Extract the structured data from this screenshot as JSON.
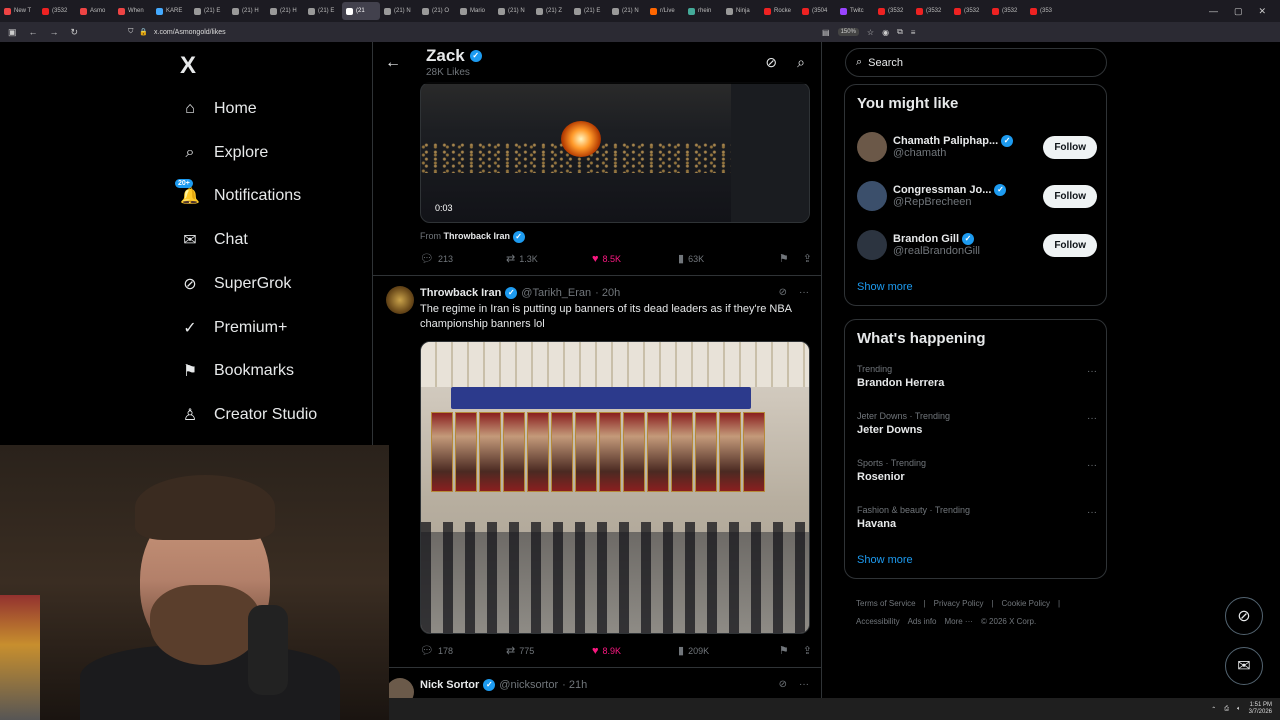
{
  "browser": {
    "tabs": [
      {
        "label": "New T",
        "color": "#e44"
      },
      {
        "label": "(3532",
        "color": "#e22"
      },
      {
        "label": "Asmo",
        "color": "#e44"
      },
      {
        "label": "When",
        "color": "#e44"
      },
      {
        "label": "KARE",
        "color": "#4af"
      },
      {
        "label": "(21) E",
        "color": "#999"
      },
      {
        "label": "(21) H",
        "color": "#999"
      },
      {
        "label": "(21) H",
        "color": "#999"
      },
      {
        "label": "(21) E",
        "color": "#999"
      },
      {
        "label": "(21",
        "color": "#fff",
        "active": true
      },
      {
        "label": "(21) N",
        "color": "#999"
      },
      {
        "label": "(21) O",
        "color": "#999"
      },
      {
        "label": "Mario",
        "color": "#999"
      },
      {
        "label": "(21) N",
        "color": "#999"
      },
      {
        "label": "(21) Z",
        "color": "#999"
      },
      {
        "label": "(21) E",
        "color": "#999"
      },
      {
        "label": "(21) N",
        "color": "#999"
      },
      {
        "label": "r/Live",
        "color": "#f60"
      },
      {
        "label": "rhein",
        "color": "#4a9"
      },
      {
        "label": "Ninja",
        "color": "#999"
      },
      {
        "label": "Rocke",
        "color": "#e22"
      },
      {
        "label": "(3504",
        "color": "#e22"
      },
      {
        "label": "Twitc",
        "color": "#94f"
      },
      {
        "label": "(3532",
        "color": "#e22"
      },
      {
        "label": "(3532",
        "color": "#e22"
      },
      {
        "label": "(3532",
        "color": "#e22"
      },
      {
        "label": "(3532",
        "color": "#e22"
      },
      {
        "label": "(353",
        "color": "#e22"
      }
    ],
    "url": "x.com/Asmongold/likes",
    "zoom": "150%"
  },
  "nav": {
    "logo": "X",
    "items": [
      {
        "label": "Home",
        "icon": "home-icon",
        "glyph": "⌂"
      },
      {
        "label": "Explore",
        "icon": "search-icon",
        "glyph": "⌕"
      },
      {
        "label": "Notifications",
        "icon": "bell-icon",
        "glyph": "🔔"
      },
      {
        "label": "Chat",
        "icon": "mail-icon",
        "glyph": "✉"
      },
      {
        "label": "SuperGrok",
        "icon": "grok-icon",
        "glyph": "⊘"
      },
      {
        "label": "Premium+",
        "icon": "premium-icon",
        "glyph": "✓"
      },
      {
        "label": "Bookmarks",
        "icon": "bookmark-icon",
        "glyph": "⚑"
      },
      {
        "label": "Creator Studio",
        "icon": "creator-icon",
        "glyph": "♙"
      }
    ],
    "notifications_badge": "20+"
  },
  "header": {
    "name": "Zack",
    "sub": "28K Likes"
  },
  "post1": {
    "timer": "0:03",
    "from_prefix": "From",
    "from_name": "Throwback Iran",
    "replies": "213",
    "reposts": "1.3K",
    "likes": "8.5K",
    "views": "63K"
  },
  "post2": {
    "name": "Throwback Iran",
    "handle": "@Tarikh_Eran",
    "time": "· 20h",
    "text": "The regime in Iran is putting up banners of its dead leaders as if they're NBA championship banners lol",
    "replies": "178",
    "reposts": "775",
    "likes": "8.9K",
    "views": "209K"
  },
  "post3": {
    "name": "Nick Sortor",
    "handle": "@nicksortor",
    "time": "· 21h"
  },
  "sidebar": {
    "search_placeholder": "Search",
    "you_might_like": "You might like",
    "suggestions": [
      {
        "name": "Chamath Paliphap...",
        "handle": "@chamath",
        "follow": "Follow",
        "avatar": "#6b5848"
      },
      {
        "name": "Congressman Jo...",
        "handle": "@RepBrecheen",
        "follow": "Follow",
        "avatar": "#3b4f6b"
      },
      {
        "name": "Brandon Gill",
        "handle": "@realBrandonGill",
        "follow": "Follow",
        "avatar": "#2c3440"
      }
    ],
    "show_more": "Show more",
    "whats_happening": "What's happening",
    "trends": [
      {
        "meta": "Trending",
        "title": "Brandon Herrera"
      },
      {
        "meta": "Jeter Downs · Trending",
        "title": "Jeter Downs"
      },
      {
        "meta": "Sports · Trending",
        "title": "Rosenior"
      },
      {
        "meta": "Fashion & beauty · Trending",
        "title": "Havana"
      }
    ],
    "show_more2": "Show more",
    "footer_links": [
      "Terms of Service",
      "|",
      "Privacy Policy",
      "|",
      "Cookie Policy",
      "|",
      "Accessibility",
      "Ads info",
      "More ···",
      "© 2026 X Corp."
    ]
  },
  "taskbar": {
    "time": "1:51 PM",
    "date": "3/7/2026"
  },
  "colors": {
    "accent": "#1d9bf0",
    "like": "#f91880",
    "muted": "#71767b",
    "border": "#2f3336"
  }
}
